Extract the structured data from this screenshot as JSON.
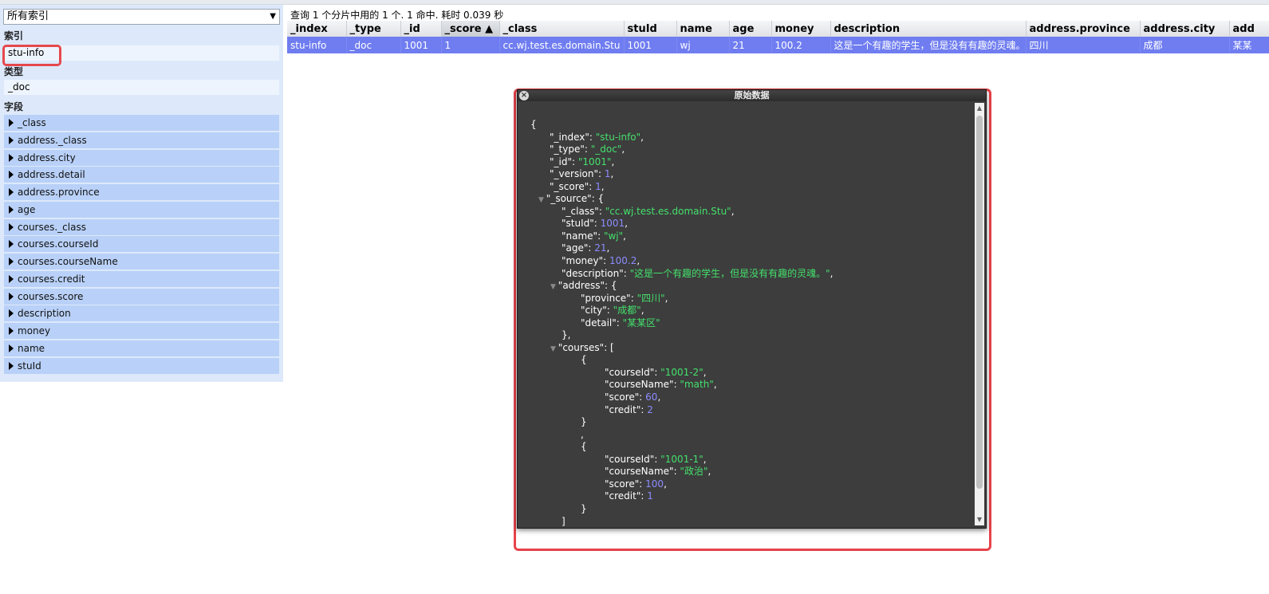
{
  "left": {
    "index_select": "所有索引",
    "index_heading": "索引",
    "index_value": "stu-info",
    "type_heading": "类型",
    "type_value": "_doc",
    "fields_heading": "字段",
    "fields": [
      "_class",
      "address._class",
      "address.city",
      "address.detail",
      "address.province",
      "age",
      "courses._class",
      "courses.courseId",
      "courses.courseName",
      "courses.credit",
      "courses.score",
      "description",
      "money",
      "name",
      "stuId"
    ]
  },
  "summary": "查询 1 个分片中用的 1 个. 1 命中. 耗时 0.039 秒",
  "table": {
    "columns": [
      "_index",
      "_type",
      "_id",
      "_score ▲",
      "_class",
      "stuId",
      "name",
      "age",
      "money",
      "description",
      "address.province",
      "address.city",
      "add"
    ],
    "row": [
      "stu-info",
      "_doc",
      "1001",
      "1",
      "cc.wj.test.es.domain.Stu",
      "1001",
      "wj",
      "21",
      "100.2",
      "这是一个有趣的学生，但是没有有趣的灵魂。",
      "四川",
      "成都",
      "某某"
    ]
  },
  "modal": {
    "title": "原始数据",
    "close_icon": "close-icon",
    "lines": [
      [
        0,
        [
          [
            "p",
            "{"
          ]
        ]
      ],
      [
        1,
        [
          [
            "k",
            "\"_index\""
          ],
          [
            "p",
            ": "
          ],
          [
            "s",
            "\"stu-info\""
          ],
          [
            "p",
            ","
          ]
        ]
      ],
      [
        1,
        [
          [
            "k",
            "\"_type\""
          ],
          [
            "p",
            ": "
          ],
          [
            "s",
            "\"_doc\""
          ],
          [
            "p",
            ","
          ]
        ]
      ],
      [
        1,
        [
          [
            "k",
            "\"_id\""
          ],
          [
            "p",
            ": "
          ],
          [
            "s",
            "\"1001\""
          ],
          [
            "p",
            ","
          ]
        ]
      ],
      [
        1,
        [
          [
            "k",
            "\"_version\""
          ],
          [
            "p",
            ": "
          ],
          [
            "n",
            "1"
          ],
          [
            "p",
            ","
          ]
        ]
      ],
      [
        1,
        [
          [
            "k",
            "\"_score\""
          ],
          [
            "p",
            ": "
          ],
          [
            "n",
            "1"
          ],
          [
            "p",
            ","
          ]
        ]
      ],
      [
        1,
        [
          [
            "t",
            "▼ "
          ],
          [
            "k",
            "\"_source\""
          ],
          [
            "p",
            ": {"
          ]
        ]
      ],
      [
        2,
        [
          [
            "k",
            "\"_class\""
          ],
          [
            "p",
            ": "
          ],
          [
            "s",
            "\"cc.wj.test.es.domain.Stu\""
          ],
          [
            "p",
            ","
          ]
        ]
      ],
      [
        2,
        [
          [
            "k",
            "\"stuId\""
          ],
          [
            "p",
            ": "
          ],
          [
            "n",
            "1001"
          ],
          [
            "p",
            ","
          ]
        ]
      ],
      [
        2,
        [
          [
            "k",
            "\"name\""
          ],
          [
            "p",
            ": "
          ],
          [
            "s",
            "\"wj\""
          ],
          [
            "p",
            ","
          ]
        ]
      ],
      [
        2,
        [
          [
            "k",
            "\"age\""
          ],
          [
            "p",
            ": "
          ],
          [
            "n",
            "21"
          ],
          [
            "p",
            ","
          ]
        ]
      ],
      [
        2,
        [
          [
            "k",
            "\"money\""
          ],
          [
            "p",
            ": "
          ],
          [
            "n",
            "100.2"
          ],
          [
            "p",
            ","
          ]
        ]
      ],
      [
        2,
        [
          [
            "k",
            "\"description\""
          ],
          [
            "p",
            ": "
          ],
          [
            "s",
            "\"这是一个有趣的学生，但是没有有趣的灵魂。\""
          ],
          [
            "p",
            ","
          ]
        ]
      ],
      [
        2,
        [
          [
            "t",
            "▼ "
          ],
          [
            "k",
            "\"address\""
          ],
          [
            "p",
            ": {"
          ]
        ]
      ],
      [
        3,
        [
          [
            "k",
            "\"province\""
          ],
          [
            "p",
            ": "
          ],
          [
            "s",
            "\"四川\""
          ],
          [
            "p",
            ","
          ]
        ]
      ],
      [
        3,
        [
          [
            "k",
            "\"city\""
          ],
          [
            "p",
            ": "
          ],
          [
            "s",
            "\"成都\""
          ],
          [
            "p",
            ","
          ]
        ]
      ],
      [
        3,
        [
          [
            "k",
            "\"detail\""
          ],
          [
            "p",
            ": "
          ],
          [
            "s",
            "\"某某区\""
          ]
        ]
      ],
      [
        2,
        [
          [
            "p",
            "},"
          ]
        ]
      ],
      [
        2,
        [
          [
            "t",
            "▼ "
          ],
          [
            "k",
            "\"courses\""
          ],
          [
            "p",
            ": ["
          ]
        ]
      ],
      [
        3,
        [
          [
            "p",
            "{"
          ]
        ]
      ],
      [
        4,
        [
          [
            "k",
            "\"courseId\""
          ],
          [
            "p",
            ": "
          ],
          [
            "s",
            "\"1001-2\""
          ],
          [
            "p",
            ","
          ]
        ]
      ],
      [
        4,
        [
          [
            "k",
            "\"courseName\""
          ],
          [
            "p",
            ": "
          ],
          [
            "s",
            "\"math\""
          ],
          [
            "p",
            ","
          ]
        ]
      ],
      [
        4,
        [
          [
            "k",
            "\"score\""
          ],
          [
            "p",
            ": "
          ],
          [
            "n",
            "60"
          ],
          [
            "p",
            ","
          ]
        ]
      ],
      [
        4,
        [
          [
            "k",
            "\"credit\""
          ],
          [
            "p",
            ": "
          ],
          [
            "n",
            "2"
          ]
        ]
      ],
      [
        3,
        [
          [
            "p",
            "}"
          ]
        ]
      ],
      [
        3,
        [
          [
            "p",
            ","
          ]
        ]
      ],
      [
        3,
        [
          [
            "p",
            "{"
          ]
        ]
      ],
      [
        4,
        [
          [
            "k",
            "\"courseId\""
          ],
          [
            "p",
            ": "
          ],
          [
            "s",
            "\"1001-1\""
          ],
          [
            "p",
            ","
          ]
        ]
      ],
      [
        4,
        [
          [
            "k",
            "\"courseName\""
          ],
          [
            "p",
            ": "
          ],
          [
            "s",
            "\"政治\""
          ],
          [
            "p",
            ","
          ]
        ]
      ],
      [
        4,
        [
          [
            "k",
            "\"score\""
          ],
          [
            "p",
            ": "
          ],
          [
            "n",
            "100"
          ],
          [
            "p",
            ","
          ]
        ]
      ],
      [
        4,
        [
          [
            "k",
            "\"credit\""
          ],
          [
            "p",
            ": "
          ],
          [
            "n",
            "1"
          ]
        ]
      ],
      [
        3,
        [
          [
            "p",
            "}"
          ]
        ]
      ],
      [
        2,
        [
          [
            "p",
            "]"
          ]
        ]
      ],
      [
        1,
        [
          [
            "p",
            "}"
          ]
        ]
      ]
    ]
  },
  "colors": {
    "row_selected": "#6f7df0",
    "highlight": "#e5484d",
    "json_string": "#44e06c",
    "json_number": "#8c8cff"
  }
}
